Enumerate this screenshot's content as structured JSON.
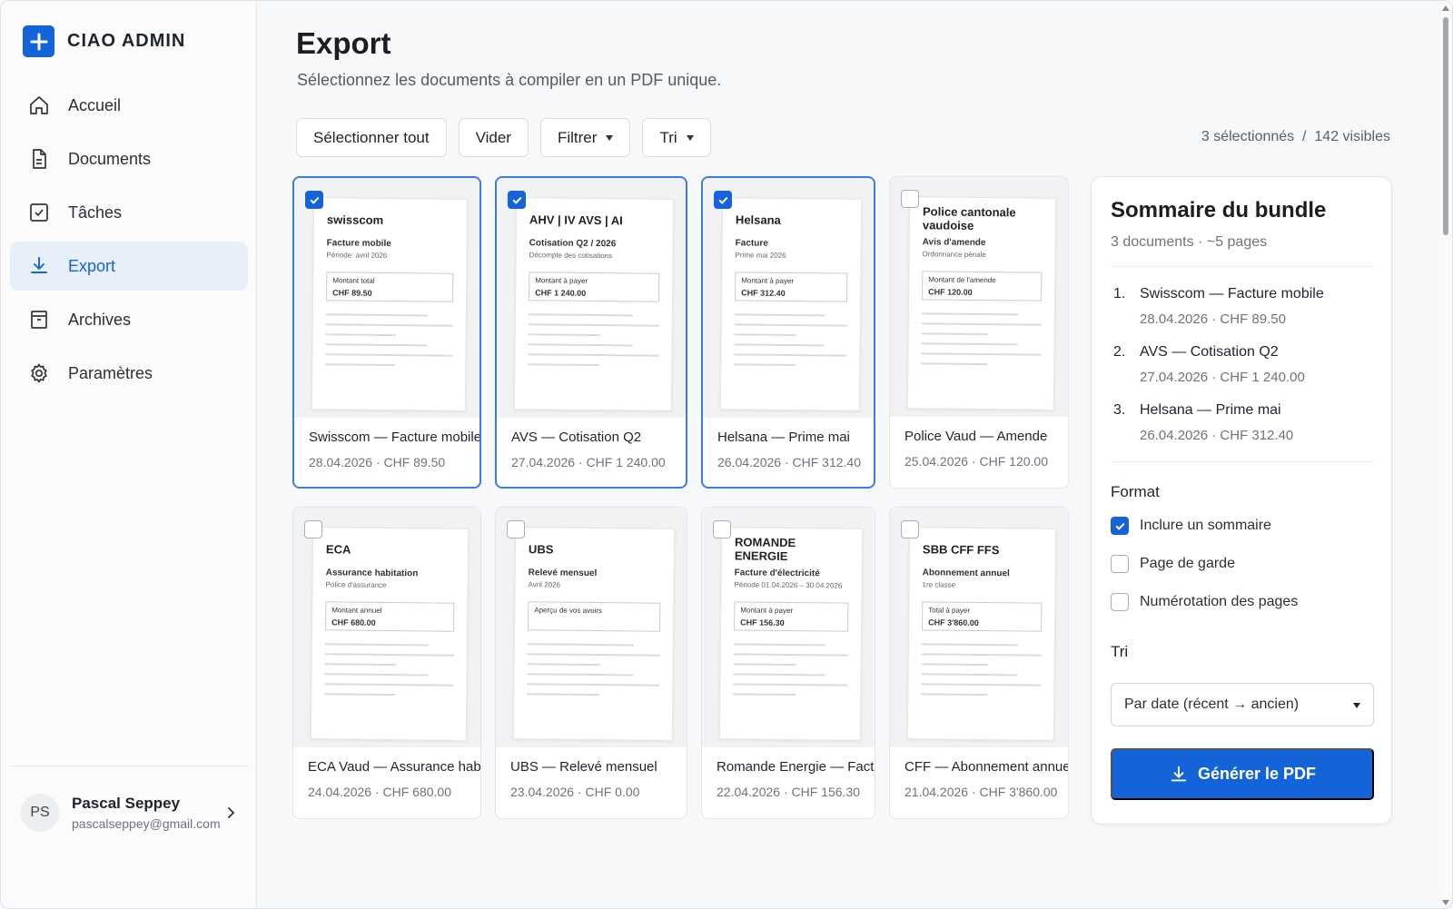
{
  "app": {
    "brand": "CIAO ADMIN"
  },
  "sidebar": {
    "items": [
      {
        "label": "Accueil",
        "icon": "home-icon"
      },
      {
        "label": "Documents",
        "icon": "document-icon"
      },
      {
        "label": "Tâches",
        "icon": "checkbox-icon"
      },
      {
        "label": "Export",
        "icon": "download-icon",
        "active": true
      },
      {
        "label": "Archives",
        "icon": "archive-icon"
      },
      {
        "label": "Paramètres",
        "icon": "gear-icon"
      }
    ],
    "user": {
      "initials": "PS",
      "name": "Pascal Seppey",
      "email": "pascalseppey@gmail.com"
    }
  },
  "page": {
    "title": "Export",
    "subtitle": "Sélectionnez les documents à compiler en un PDF unique."
  },
  "toolbar": {
    "select_all": "Sélectionner tout",
    "clear": "Vider",
    "filter": "Filtrer",
    "sort": "Tri",
    "count": "3 sélectionnés  /  142 visibles"
  },
  "cards": [
    {
      "title": "Swisscom — Facture mobile",
      "meta": "28.04.2026 · CHF 89.50",
      "selected": true,
      "doc": {
        "logo": "swisscom",
        "head": "Facture mobile",
        "sub": "Période: avril 2026",
        "box_label": "Montant total",
        "amount": "CHF 89.50"
      }
    },
    {
      "title": "AVS — Cotisation Q2",
      "meta": "27.04.2026 · CHF 1 240.00",
      "selected": true,
      "doc": {
        "logo": "AHV | IV  AVS | AI",
        "head": "Cotisation Q2 / 2026",
        "sub": "Décompte des cotisations",
        "box_label": "Montant à payer",
        "amount": "CHF 1 240.00"
      }
    },
    {
      "title": "Helsana — Prime mai",
      "meta": "26.04.2026 · CHF 312.40",
      "selected": true,
      "doc": {
        "logo": "Helsana",
        "head": "Facture",
        "sub": "Prime mai 2026",
        "box_label": "Montant à payer",
        "amount": "CHF 312.40"
      }
    },
    {
      "title": "Police Vaud — Amende",
      "meta": "25.04.2026 · CHF 120.00",
      "selected": false,
      "doc": {
        "logo": "Police cantonale vaudoise",
        "head": "Avis d'amende",
        "sub": "Ordonnance pénale",
        "box_label": "Montant de l'amende",
        "amount": "CHF 120.00"
      }
    },
    {
      "title": "ECA Vaud — Assurance habitation",
      "meta": "24.04.2026 · CHF 680.00",
      "selected": false,
      "doc": {
        "logo": "ECA",
        "head": "Assurance habitation",
        "sub": "Police d'assurance",
        "box_label": "Montant annuel",
        "amount": "CHF 680.00"
      }
    },
    {
      "title": "UBS — Relevé mensuel",
      "meta": "23.04.2026 · CHF 0.00",
      "selected": false,
      "doc": {
        "logo": "UBS",
        "head": "Relevé mensuel",
        "sub": "Avril 2026",
        "box_label": "Aperçu de vos avoirs",
        "amount": ""
      }
    },
    {
      "title": "Romande Energie — Facture",
      "meta": "22.04.2026 · CHF 156.30",
      "selected": false,
      "doc": {
        "logo": "ROMANDE ENERGIE",
        "head": "Facture d'électricité",
        "sub": "Période 01.04.2026 – 30.04.2026",
        "box_label": "Montant à payer",
        "amount": "CHF 156.30"
      }
    },
    {
      "title": "CFF — Abonnement annuel",
      "meta": "21.04.2026 · CHF 3'860.00",
      "selected": false,
      "doc": {
        "logo": "SBB CFF FFS",
        "head": "Abonnement annuel",
        "sub": "1re classe",
        "box_label": "Total à payer",
        "amount": "CHF 3'860.00"
      }
    }
  ],
  "summary": {
    "title": "Sommaire du bundle",
    "subtitle": "3 documents · ~5 pages",
    "items": [
      {
        "num": "1.",
        "name": "Swisscom — Facture mobile",
        "meta": "28.04.2026 · CHF 89.50"
      },
      {
        "num": "2.",
        "name": "AVS — Cotisation Q2",
        "meta": "27.04.2026 · CHF 1 240.00"
      },
      {
        "num": "3.",
        "name": "Helsana — Prime mai",
        "meta": "26.04.2026 · CHF 312.40"
      }
    ],
    "format_label": "Format",
    "options": [
      {
        "label": "Inclure un sommaire",
        "checked": true
      },
      {
        "label": "Page de garde",
        "checked": false
      },
      {
        "label": "Numérotation des pages",
        "checked": false
      }
    ],
    "sort_label": "Tri",
    "sort_value": "Par date (récent → ancien)",
    "generate": "Générer le PDF"
  },
  "colors": {
    "accent": "#1463d8",
    "active_bg": "#e7effb",
    "selected_border": "#3c7be0"
  }
}
